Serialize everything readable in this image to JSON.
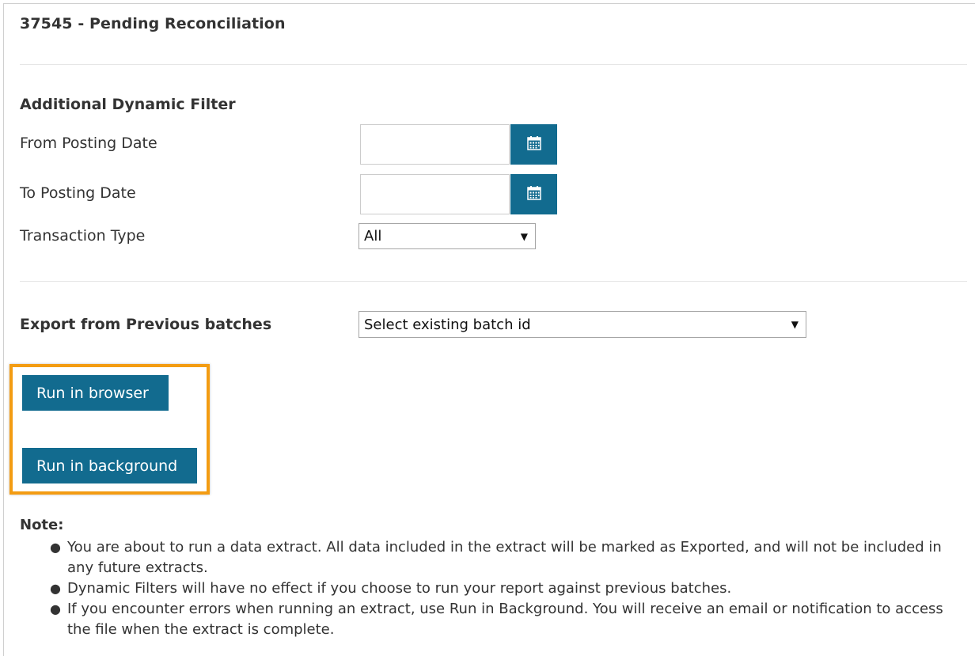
{
  "page": {
    "title": "37545 - Pending Reconciliation"
  },
  "filters": {
    "section_title": "Additional Dynamic Filter",
    "from_posting_date": {
      "label": "From Posting Date",
      "value": ""
    },
    "to_posting_date": {
      "label": "To Posting Date",
      "value": ""
    },
    "transaction_type": {
      "label": "Transaction Type",
      "selected": "All"
    },
    "calendar_icon": "calendar-icon"
  },
  "export": {
    "label": "Export from Previous batches",
    "selected": "Select existing batch id"
  },
  "actions": {
    "run_in_browser": "Run in browser",
    "run_in_background": "Run in background"
  },
  "note": {
    "title": "Note:",
    "items": [
      "You are about to run a data extract. All data included in the extract will be marked as Exported, and will not be included in any future extracts.",
      "Dynamic Filters will have no effect if you choose to run your report against previous batches.",
      "If you encounter errors when running an extract, use Run in Background. You will receive an email or notification to access the file when the extract is complete."
    ]
  },
  "colors": {
    "primary": "#126b8f",
    "highlight": "#f39c12"
  }
}
